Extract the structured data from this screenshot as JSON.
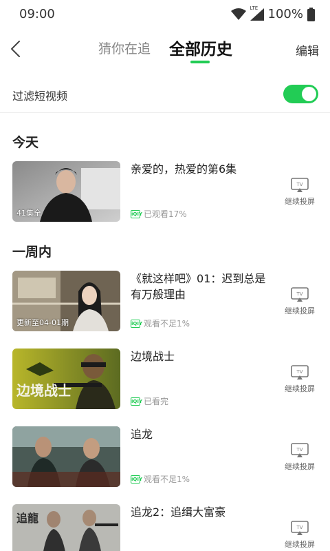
{
  "status_bar": {
    "time": "09:00",
    "network": "LTE",
    "battery": "100%"
  },
  "nav": {
    "tabs": [
      {
        "label": "猜你在追"
      },
      {
        "label": "全部历史"
      }
    ],
    "active_tab": "全部历史",
    "edit_label": "编辑"
  },
  "filter": {
    "label": "过滤短视频",
    "enabled": true
  },
  "sections": [
    {
      "title": "今天",
      "items": [
        {
          "title": "亲爱的，热爱的第6集",
          "badge": "41集全",
          "progress": "已观看17%",
          "cast_label": "继续投屏"
        }
      ]
    },
    {
      "title": "一周内",
      "items": [
        {
          "title": "《就这样吧》01：迟到总是有万般理由",
          "badge": "更新至04-01期",
          "progress": "观看不足1%",
          "cast_label": "继续投屏"
        },
        {
          "title": "边境战士",
          "badge": "",
          "poster_text": "边境战士",
          "progress": "已看完",
          "cast_label": "继续投屏"
        },
        {
          "title": "追龙",
          "badge": "",
          "progress": "观看不足1%",
          "cast_label": "继续投屏"
        },
        {
          "title": "追龙2：追缉大富豪",
          "badge": "",
          "poster_text": "追龍",
          "progress": "",
          "cast_label": "继续投屏"
        }
      ]
    }
  ],
  "icons": {
    "back": "chevron-left-icon",
    "wifi": "wifi-icon",
    "signal": "cellular-signal-icon",
    "battery": "battery-icon",
    "cast": "tv-cast-icon",
    "source": "iqiyi-badge-icon"
  },
  "colors": {
    "accent": "#22cc55",
    "text_primary": "#222222",
    "text_secondary": "#999999"
  }
}
